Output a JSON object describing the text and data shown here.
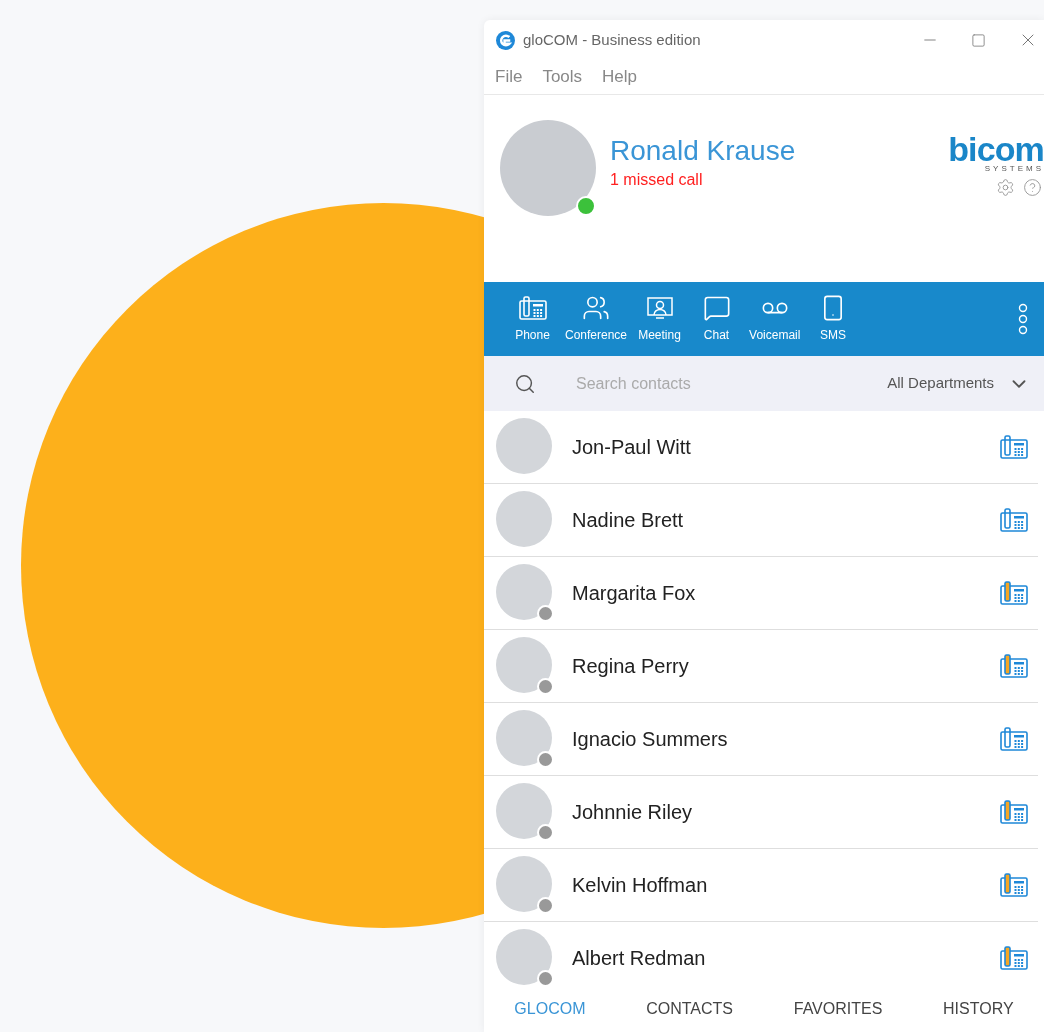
{
  "window": {
    "title": "gloCOM - Business edition"
  },
  "menu": [
    "File",
    "Tools",
    "Help"
  ],
  "profile": {
    "name": "Ronald Krause",
    "notice": "1 missed call",
    "online": true
  },
  "brand": {
    "logo_text": "bicom",
    "logo_subtext": "SYSTEMS"
  },
  "toolbar": [
    {
      "label": "Phone",
      "kind": "phone"
    },
    {
      "label": "Conference",
      "kind": "conference"
    },
    {
      "label": "Meeting",
      "kind": "meeting"
    },
    {
      "label": "Chat",
      "kind": "chat"
    },
    {
      "label": "Voicemail",
      "kind": "voicemail"
    },
    {
      "label": "SMS",
      "kind": "sms"
    }
  ],
  "search": {
    "placeholder": "Search contacts"
  },
  "department_filter": {
    "value": "All Departments"
  },
  "contacts": [
    {
      "name": "Jon-Paul Witt",
      "offline": false,
      "phone_busy": false
    },
    {
      "name": "Nadine Brett",
      "offline": false,
      "phone_busy": false
    },
    {
      "name": "Margarita Fox",
      "offline": true,
      "phone_busy": true
    },
    {
      "name": "Regina Perry",
      "offline": true,
      "phone_busy": true
    },
    {
      "name": "Ignacio Summers",
      "offline": true,
      "phone_busy": false
    },
    {
      "name": "Johnnie Riley",
      "offline": true,
      "phone_busy": true
    },
    {
      "name": "Kelvin Hoffman",
      "offline": true,
      "phone_busy": true
    },
    {
      "name": "Albert Redman",
      "offline": true,
      "phone_busy": true
    }
  ],
  "bottom_tabs": [
    {
      "label": "GLOCOM",
      "selected": true
    },
    {
      "label": "CONTACTS",
      "selected": false
    },
    {
      "label": "FAVORITES",
      "selected": false
    },
    {
      "label": "HISTORY",
      "selected": false
    }
  ]
}
